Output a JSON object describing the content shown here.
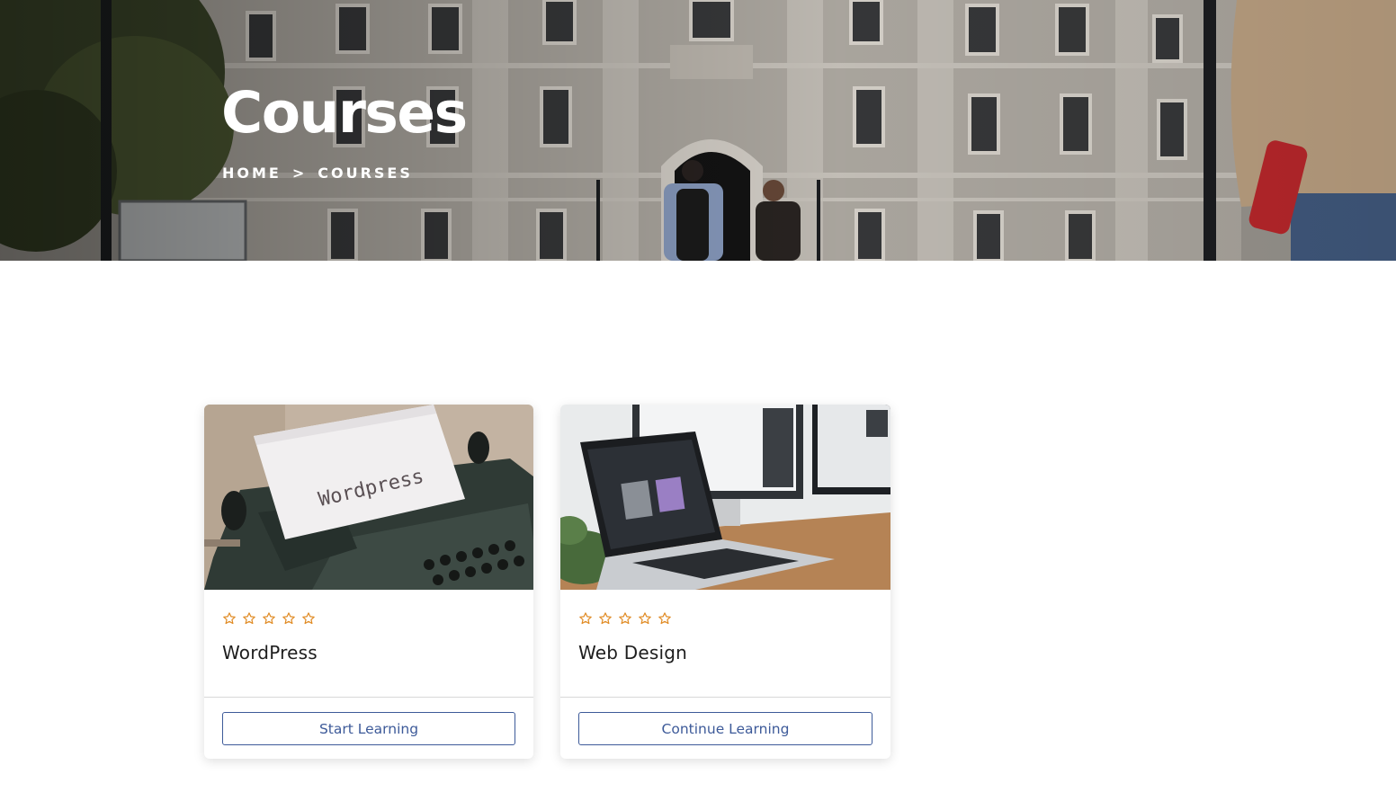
{
  "hero": {
    "title": "Courses",
    "breadcrumb": {
      "home": "HOME",
      "separator": ">",
      "current": "COURSES"
    }
  },
  "colors": {
    "star": "#e08a22",
    "button": "#3d5a99",
    "title_text": "#1e1e1e"
  },
  "courses": [
    {
      "image": "typewriter-with-wordpress-paper",
      "image_text": "Wordpress",
      "rating_icons": [
        "star-outline-icon",
        "star-outline-icon",
        "star-outline-icon",
        "star-outline-icon",
        "star-outline-icon"
      ],
      "title": "WordPress",
      "button_label": "Start Learning"
    },
    {
      "image": "laptop-and-monitors-on-desk",
      "rating_icons": [
        "star-outline-icon",
        "star-outline-icon",
        "star-outline-icon",
        "star-outline-icon",
        "star-outline-icon"
      ],
      "title": "Web Design",
      "button_label": "Continue Learning"
    }
  ]
}
